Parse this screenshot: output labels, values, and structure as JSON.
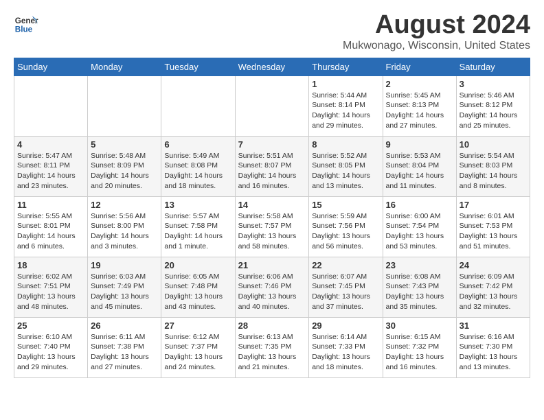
{
  "logo": {
    "line1": "General",
    "line2": "Blue"
  },
  "title": "August 2024",
  "subtitle": "Mukwonago, Wisconsin, United States",
  "days_of_week": [
    "Sunday",
    "Monday",
    "Tuesday",
    "Wednesday",
    "Thursday",
    "Friday",
    "Saturday"
  ],
  "weeks": [
    [
      {
        "day": "",
        "sunrise": "",
        "sunset": "",
        "daylight": ""
      },
      {
        "day": "",
        "sunrise": "",
        "sunset": "",
        "daylight": ""
      },
      {
        "day": "",
        "sunrise": "",
        "sunset": "",
        "daylight": ""
      },
      {
        "day": "",
        "sunrise": "",
        "sunset": "",
        "daylight": ""
      },
      {
        "day": "1",
        "sunrise": "Sunrise: 5:44 AM",
        "sunset": "Sunset: 8:14 PM",
        "daylight": "Daylight: 14 hours and 29 minutes."
      },
      {
        "day": "2",
        "sunrise": "Sunrise: 5:45 AM",
        "sunset": "Sunset: 8:13 PM",
        "daylight": "Daylight: 14 hours and 27 minutes."
      },
      {
        "day": "3",
        "sunrise": "Sunrise: 5:46 AM",
        "sunset": "Sunset: 8:12 PM",
        "daylight": "Daylight: 14 hours and 25 minutes."
      }
    ],
    [
      {
        "day": "4",
        "sunrise": "Sunrise: 5:47 AM",
        "sunset": "Sunset: 8:11 PM",
        "daylight": "Daylight: 14 hours and 23 minutes."
      },
      {
        "day": "5",
        "sunrise": "Sunrise: 5:48 AM",
        "sunset": "Sunset: 8:09 PM",
        "daylight": "Daylight: 14 hours and 20 minutes."
      },
      {
        "day": "6",
        "sunrise": "Sunrise: 5:49 AM",
        "sunset": "Sunset: 8:08 PM",
        "daylight": "Daylight: 14 hours and 18 minutes."
      },
      {
        "day": "7",
        "sunrise": "Sunrise: 5:51 AM",
        "sunset": "Sunset: 8:07 PM",
        "daylight": "Daylight: 14 hours and 16 minutes."
      },
      {
        "day": "8",
        "sunrise": "Sunrise: 5:52 AM",
        "sunset": "Sunset: 8:05 PM",
        "daylight": "Daylight: 14 hours and 13 minutes."
      },
      {
        "day": "9",
        "sunrise": "Sunrise: 5:53 AM",
        "sunset": "Sunset: 8:04 PM",
        "daylight": "Daylight: 14 hours and 11 minutes."
      },
      {
        "day": "10",
        "sunrise": "Sunrise: 5:54 AM",
        "sunset": "Sunset: 8:03 PM",
        "daylight": "Daylight: 14 hours and 8 minutes."
      }
    ],
    [
      {
        "day": "11",
        "sunrise": "Sunrise: 5:55 AM",
        "sunset": "Sunset: 8:01 PM",
        "daylight": "Daylight: 14 hours and 6 minutes."
      },
      {
        "day": "12",
        "sunrise": "Sunrise: 5:56 AM",
        "sunset": "Sunset: 8:00 PM",
        "daylight": "Daylight: 14 hours and 3 minutes."
      },
      {
        "day": "13",
        "sunrise": "Sunrise: 5:57 AM",
        "sunset": "Sunset: 7:58 PM",
        "daylight": "Daylight: 14 hours and 1 minute."
      },
      {
        "day": "14",
        "sunrise": "Sunrise: 5:58 AM",
        "sunset": "Sunset: 7:57 PM",
        "daylight": "Daylight: 13 hours and 58 minutes."
      },
      {
        "day": "15",
        "sunrise": "Sunrise: 5:59 AM",
        "sunset": "Sunset: 7:56 PM",
        "daylight": "Daylight: 13 hours and 56 minutes."
      },
      {
        "day": "16",
        "sunrise": "Sunrise: 6:00 AM",
        "sunset": "Sunset: 7:54 PM",
        "daylight": "Daylight: 13 hours and 53 minutes."
      },
      {
        "day": "17",
        "sunrise": "Sunrise: 6:01 AM",
        "sunset": "Sunset: 7:53 PM",
        "daylight": "Daylight: 13 hours and 51 minutes."
      }
    ],
    [
      {
        "day": "18",
        "sunrise": "Sunrise: 6:02 AM",
        "sunset": "Sunset: 7:51 PM",
        "daylight": "Daylight: 13 hours and 48 minutes."
      },
      {
        "day": "19",
        "sunrise": "Sunrise: 6:03 AM",
        "sunset": "Sunset: 7:49 PM",
        "daylight": "Daylight: 13 hours and 45 minutes."
      },
      {
        "day": "20",
        "sunrise": "Sunrise: 6:05 AM",
        "sunset": "Sunset: 7:48 PM",
        "daylight": "Daylight: 13 hours and 43 minutes."
      },
      {
        "day": "21",
        "sunrise": "Sunrise: 6:06 AM",
        "sunset": "Sunset: 7:46 PM",
        "daylight": "Daylight: 13 hours and 40 minutes."
      },
      {
        "day": "22",
        "sunrise": "Sunrise: 6:07 AM",
        "sunset": "Sunset: 7:45 PM",
        "daylight": "Daylight: 13 hours and 37 minutes."
      },
      {
        "day": "23",
        "sunrise": "Sunrise: 6:08 AM",
        "sunset": "Sunset: 7:43 PM",
        "daylight": "Daylight: 13 hours and 35 minutes."
      },
      {
        "day": "24",
        "sunrise": "Sunrise: 6:09 AM",
        "sunset": "Sunset: 7:42 PM",
        "daylight": "Daylight: 13 hours and 32 minutes."
      }
    ],
    [
      {
        "day": "25",
        "sunrise": "Sunrise: 6:10 AM",
        "sunset": "Sunset: 7:40 PM",
        "daylight": "Daylight: 13 hours and 29 minutes."
      },
      {
        "day": "26",
        "sunrise": "Sunrise: 6:11 AM",
        "sunset": "Sunset: 7:38 PM",
        "daylight": "Daylight: 13 hours and 27 minutes."
      },
      {
        "day": "27",
        "sunrise": "Sunrise: 6:12 AM",
        "sunset": "Sunset: 7:37 PM",
        "daylight": "Daylight: 13 hours and 24 minutes."
      },
      {
        "day": "28",
        "sunrise": "Sunrise: 6:13 AM",
        "sunset": "Sunset: 7:35 PM",
        "daylight": "Daylight: 13 hours and 21 minutes."
      },
      {
        "day": "29",
        "sunrise": "Sunrise: 6:14 AM",
        "sunset": "Sunset: 7:33 PM",
        "daylight": "Daylight: 13 hours and 18 minutes."
      },
      {
        "day": "30",
        "sunrise": "Sunrise: 6:15 AM",
        "sunset": "Sunset: 7:32 PM",
        "daylight": "Daylight: 13 hours and 16 minutes."
      },
      {
        "day": "31",
        "sunrise": "Sunrise: 6:16 AM",
        "sunset": "Sunset: 7:30 PM",
        "daylight": "Daylight: 13 hours and 13 minutes."
      }
    ]
  ]
}
